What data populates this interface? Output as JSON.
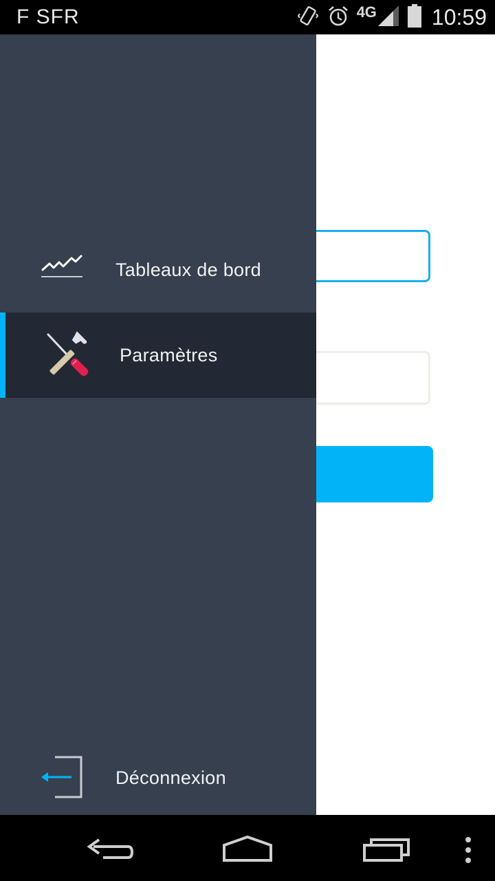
{
  "status_bar": {
    "carrier": "F SFR",
    "network": "4G",
    "time": "10:59",
    "icons": [
      "vibrate-icon",
      "alarm-icon",
      "signal-icon",
      "battery-icon"
    ]
  },
  "drawer": {
    "items": [
      {
        "label": "Tableaux de bord",
        "icon": "dashboard-chart-icon",
        "selected": false
      },
      {
        "label": "Paramètres",
        "icon": "tools-icon",
        "selected": true
      },
      {
        "label": "Déconnexion",
        "icon": "logout-icon",
        "selected": false
      }
    ]
  },
  "colors": {
    "drawer_bg": "#36404f",
    "selected_bg": "#222834",
    "accent": "#03b3f8",
    "field_focus_border": "#18b0ef",
    "field_border": "#efede7"
  },
  "system_nav": {
    "buttons": [
      "back-icon",
      "home-icon",
      "recents-icon",
      "overflow-menu-icon"
    ]
  }
}
